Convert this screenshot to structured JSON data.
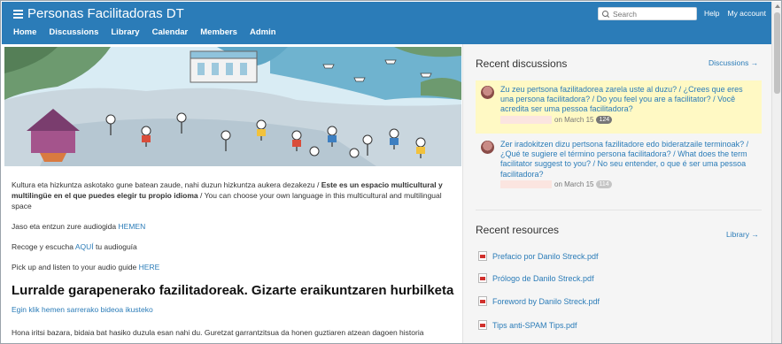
{
  "header": {
    "brand": "Personas Facilitadoras DT",
    "nav": [
      "Home",
      "Discussions",
      "Library",
      "Calendar",
      "Members",
      "Admin"
    ],
    "search_placeholder": "Search",
    "help": "Help",
    "my_account": "My account"
  },
  "left": {
    "intro_part1": "Kultura eta hizkuntza askotako gune batean zaude, nahi duzun hizkuntza aukera dezakezu / ",
    "intro_bold": "Este es un espacio multicultural y multilingüe en el que puedes elegir tu propio idioma",
    "intro_part2": " / You can choose your own language in this multicultural and multilingual space",
    "audio_eu_text": "Jaso eta entzun zure audiogida ",
    "audio_eu_link": "HEMEN",
    "audio_es_text": "Recoge y escucha ",
    "audio_es_link": "AQUÍ",
    "audio_es_suffix": " tu audioguía",
    "audio_en_text": "Pick up and listen to your audio guide ",
    "audio_en_link": "HERE",
    "heading": "Lurralde garapenerako fazilitadoreak. Gizarte eraikuntzaren hurbilketa",
    "video_link": "Egin klik hemen sarrerako bideoa ikusteko",
    "body_text": "Hona iritsi bazara, bidaia bat hasiko duzula esan nahi du. Guretzat garrantzitsua da honen guztiaren atzean dagoen historia"
  },
  "discussions": {
    "title": "Recent discussions",
    "link": "Discussions →",
    "items": [
      {
        "text": "Zu zeu pertsona fazilitadorea zarela uste al duzu? / ¿Crees que eres una persona facilitadora? / Do you feel you are a facilitator? / Você acredita ser uma pessoa facilitadora?",
        "date": "on March 15",
        "count": "124"
      },
      {
        "text": "Zer iradokitzen dizu pertsona fazilitadore edo bideratzaile terminoak? / ¿Qué te sugiere el término persona facilitadora? / What does the term facilitator suggest to you? / No seu entender, o que é ser uma pessoa facilitadora?",
        "date": "on March 15",
        "count": "114"
      }
    ]
  },
  "resources": {
    "title": "Recent resources",
    "link": "Library →",
    "items": [
      "Prefacio por Danilo Streck.pdf",
      "Prólogo de Danilo Streck.pdf",
      "Foreword by Danilo Streck.pdf",
      "Tips anti-SPAM Tips.pdf"
    ]
  },
  "colors": {
    "header_blue": "#2b7cb8",
    "link_blue": "#2b7cb8",
    "highlight_yellow": "#fff9c4",
    "sidebar_bg": "#f5f5f5"
  }
}
